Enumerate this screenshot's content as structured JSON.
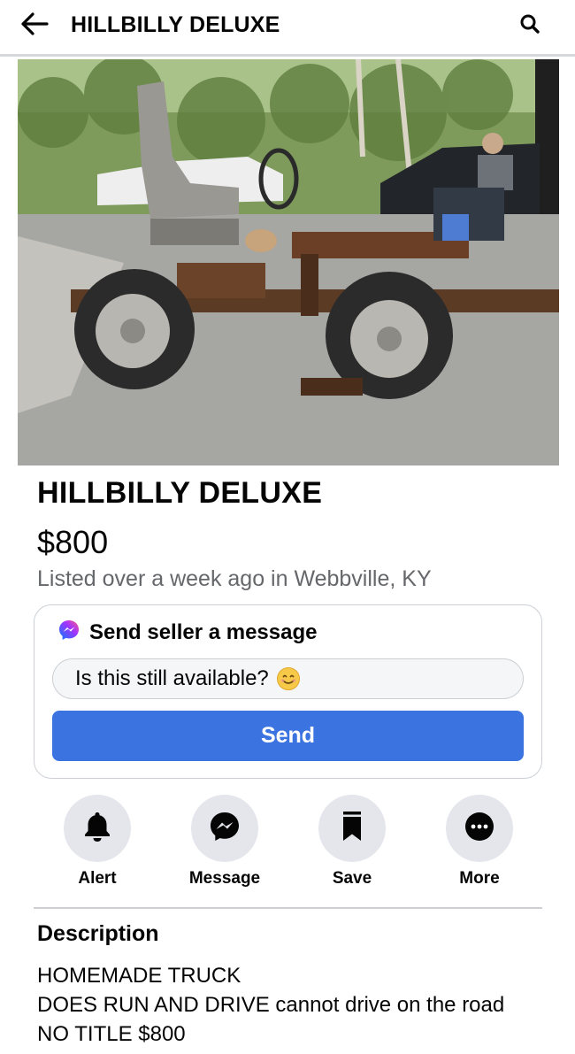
{
  "header": {
    "title": "HILLBILLY DELUXE",
    "back_icon": "arrow-left-icon",
    "search_icon": "search-icon"
  },
  "listing": {
    "title": "HILLBILLY DELUXE",
    "price": "$800",
    "meta": "Listed over a week ago in Webbville, KY"
  },
  "message_card": {
    "heading": "Send seller a message",
    "icon": "messenger-icon",
    "input_value": "Is this still available?",
    "emoji_icon": "smiley-face-icon",
    "send_label": "Send"
  },
  "actions": [
    {
      "label": "Alert",
      "icon": "bell-icon"
    },
    {
      "label": "Message",
      "icon": "messenger-icon"
    },
    {
      "label": "Save",
      "icon": "bookmark-icon"
    },
    {
      "label": "More",
      "icon": "more-dots-icon"
    }
  ],
  "description": {
    "heading": "Description",
    "lines": [
      "HOMEMADE TRUCK",
      "DOES RUN AND DRIVE cannot drive on the road",
      "NO TITLE $800"
    ]
  },
  "colors": {
    "accent": "#3b73e0",
    "text": "#050505",
    "secondary_text": "#65676b",
    "action_circle": "#e4e6eb",
    "border": "#ccd0d5"
  }
}
